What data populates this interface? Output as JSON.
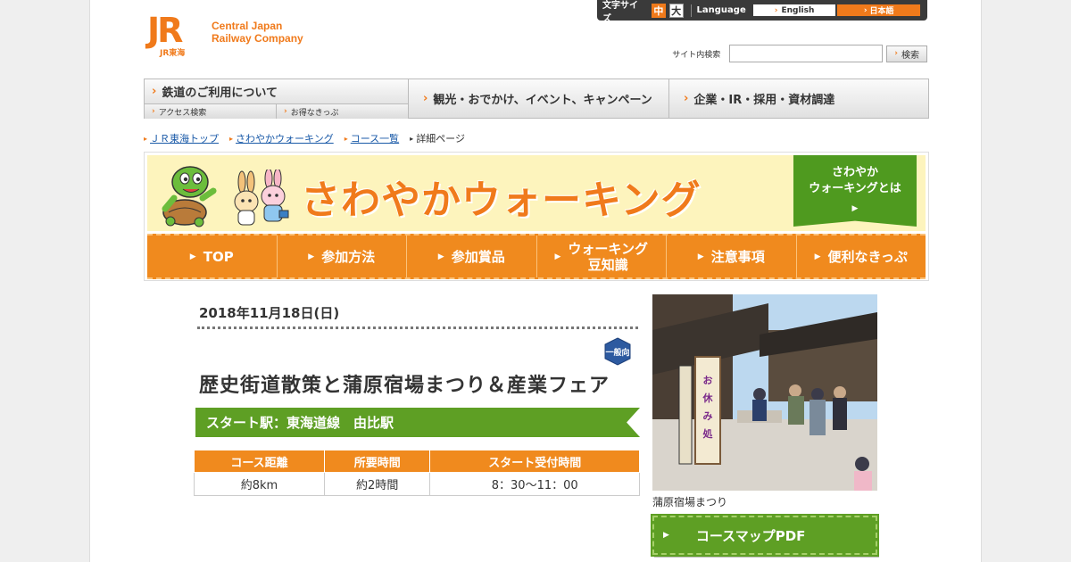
{
  "header": {
    "logo_mark": "JR",
    "logo_sub": "JR東海",
    "company_line1": "Central Japan",
    "company_line2": "Railway Company"
  },
  "topbar": {
    "font_size_label": "文字サイズ",
    "font_mid": "中",
    "font_big": "大",
    "language_label": "Language",
    "english": "English",
    "japanese": "日本語"
  },
  "search": {
    "label": "サイト内検索",
    "value": "",
    "button": "検索"
  },
  "gnav": {
    "item1": "鉄道のご利用について",
    "sub1": "アクセス検索",
    "sub2": "お得なきっぷ",
    "item2": "観光・おでかけ、イベント、キャンペーン",
    "item3": "企業・IR・採用・資材調達"
  },
  "breadcrumb": [
    "ＪＲ東海トップ",
    "さわやかウォーキング",
    "コース一覧",
    "詳細ページ"
  ],
  "banner": {
    "title": "さわやかウォーキング",
    "about_line1": "さわやか",
    "about_line2": "ウォーキングとは",
    "nav": [
      {
        "line1": "TOP",
        "line2": ""
      },
      {
        "line1": "参加方法",
        "line2": ""
      },
      {
        "line1": "参加賞品",
        "line2": ""
      },
      {
        "line1": "ウォーキング",
        "line2": "豆知識"
      },
      {
        "line1": "注意事項",
        "line2": ""
      },
      {
        "line1": "便利なきっぷ",
        "line2": ""
      }
    ]
  },
  "event": {
    "date": "2018年11月18日(日)",
    "badge": "一般向",
    "title": "歴史街道散策と蒲原宿場まつり＆産業フェア",
    "start_station": "スタート駅：東海道線　由比駅",
    "table_headers": [
      "コース距離",
      "所要時間",
      "スタート受付時間"
    ],
    "table_values": [
      "約8km",
      "約2時間",
      "8：30～11：00"
    ],
    "photo_caption": "蒲原宿場まつり",
    "pdf_button": "コースマップPDF",
    "photo_sign": "お休み処"
  },
  "colors": {
    "brand_orange": "#f07a1b",
    "walking_green": "#5e9f24",
    "banner_yellow": "#fdf4bd"
  }
}
